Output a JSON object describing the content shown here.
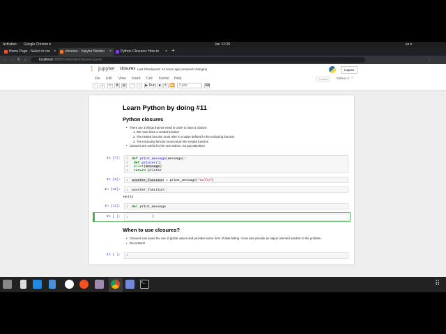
{
  "gnome": {
    "activities": "Activities",
    "app": "Google Chrome ▾",
    "clock": "Jan 12:29",
    "lang": "es ▾"
  },
  "tabs": [
    {
      "label": "Home Page - Select or cre",
      "color": "#e4572e"
    },
    {
      "label": "closures - Jupyter Notebo",
      "color": "#f37726"
    },
    {
      "label": "Python Closures: How to",
      "color": "#7b3fe4"
    }
  ],
  "address": {
    "host": "localhost",
    "path": ":8888/notebooks/closures.ipynb"
  },
  "jupyter": {
    "logo": "jupyter",
    "name": "closures",
    "checkpoint": "Last Checkpoint: 14 hours ago",
    "unsaved": "(unsaved changes)",
    "logout": "Logout",
    "trusted": "Trusted",
    "kernel": "Python 3",
    "menu": [
      "File",
      "Edit",
      "View",
      "Insert",
      "Cell",
      "Kernel",
      "Help"
    ],
    "run": "▶ Run",
    "cell_type": "Code"
  },
  "notebook": {
    "title": "Learn Python by doing #11",
    "h_closures": "Python closures",
    "b1": "There are 3 things that we need in order to have a closure:",
    "o1": "1. We must have a nested function",
    "o2": "2. The nested function must refer to a value defined in the enclosing function",
    "o3": "3. The enclosing function must return the nested function",
    "b2": "Closures are useful for the next videos. So pay attention!",
    "cells": [
      {
        "prompt": "In [7]:"
      },
      {
        "prompt": "In [9]:"
      },
      {
        "prompt": "In [10]:",
        "output": "Hello"
      },
      {
        "prompt": "In [11]:"
      },
      {
        "prompt": "In [ ]:"
      }
    ],
    "h_when": "When to use closures?",
    "w1": "Closures can avoid the use of global values and provides some form of data hiding. It can also provide an object oriented solution to the problem.",
    "w2": "Decorators!",
    "last_prompt": "In [ ]:"
  }
}
